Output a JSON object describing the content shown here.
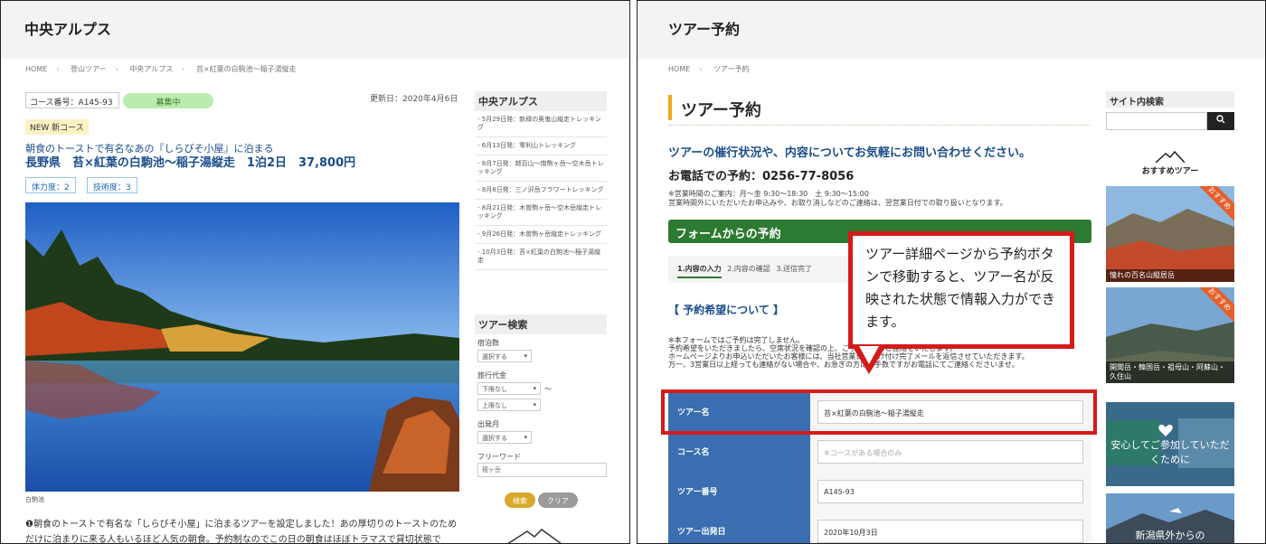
{
  "left": {
    "header_title": "中央アルプス",
    "breadcrumbs": [
      "HOME",
      "登山ツアー",
      "中央アルプス",
      "苔×紅葉の白駒池〜稲子湯縦走"
    ],
    "course_code": "コース番号：A145-93",
    "status": "募集中",
    "updated": "更新日：2020年4月6日",
    "new_tag": "NEW 新コース",
    "subtitle": "朝食のトーストで有名なあの『しらびそ小屋』に泊まる",
    "title": "長野県　苔×紅葉の白駒池〜稲子湯縦走　1泊2日　37,800円",
    "badges": [
      "体力度：2",
      "技術度：3"
    ],
    "photo_caption": "白駒池",
    "description": "❶朝食のトーストで有名な「しらびそ小屋」に泊まるツアーを設定しました！あの厚切りのトーストのためだけに泊まりに来る人もいるほど人気の朝食。予約制なのでこの日の朝食はほぼトラマスで貸切状態で",
    "sidebar": {
      "box_title": "中央アルプス",
      "items": [
        "- 5月29日発：新緑の奥鬼山縦走トレッキング",
        "- 6月13日発：零利山トレッキング",
        "- 8月7日発：越百山〜南駒ヶ岳〜空木岳トレッキング",
        "- 8月8日発：三ノ沢岳フラワートレッキング",
        "- 8月21日発：木曽駒ヶ岳〜空木岳縦走トレッキング",
        "- 9月26日発：木曽駒ヶ岳縦走トレッキング",
        "- 10月3日発：苔×紅葉の白駒池〜稲子湯縦走"
      ],
      "search_title": "ツアー検索",
      "nights_label": "宿泊数",
      "nights_value": "選択する",
      "price_label": "旅行代金",
      "price_min": "下限なし",
      "price_max": "上限なし",
      "price_sep": "〜",
      "depart_label": "出発月",
      "depart_value": "選択する",
      "keyword_label": "フリーワード",
      "keyword_placeholder": "穂ヶ岳",
      "search_button": "検索",
      "clear_button": "クリア"
    }
  },
  "right": {
    "header_title": "ツアー予約",
    "breadcrumbs": [
      "HOME",
      "ツアー予約"
    ],
    "page_title": "ツアー予約",
    "intro": "ツアーの催行状況や、内容についてお気軽にお問い合わせください。",
    "phone": "お電話での予約：0256-77-8056",
    "hours_line1": "※営業時間のご案内：月〜金 9:30〜18:30　土 9:30〜15:00",
    "hours_line2": "営業時間外にいただいたお申込みや、お取り消しなどのご連絡は、翌営業日付での取り扱いとなります。",
    "form_bar": "フォームからの予約",
    "steps": [
      "1.内容の入力",
      "2.内容の確認",
      "3.送信完了"
    ],
    "section_title": "【 予約希望について 】",
    "notes": [
      "※本フォームではご予約は完了しません。",
      "予約希望をいただきましたら、空席状況を確認の上、ご予約確定のご連絡をいたします。",
      "ホームページよりお申込いただいたお客様には、当社営業日に受け付け完了メールを返信させていただきます。",
      "万一、3営業日以上経っても連絡がない場合や、お急ぎの方はお手数ですがお電話にてご連絡くださいませ。"
    ],
    "form": [
      {
        "label": "ツアー名",
        "value": "苔×紅葉の白駒池〜稲子湯縦走",
        "placeholder": ""
      },
      {
        "label": "コース名",
        "value": "",
        "placeholder": "※コースがある場合のみ"
      },
      {
        "label": "ツアー番号",
        "value": "A145-93",
        "placeholder": ""
      },
      {
        "label": "ツアー出発日",
        "value": "2020年10月3日",
        "placeholder": ""
      }
    ],
    "callout": "ツアー詳細ページから予約ボタンで移動すると、ツアー名が反映された状態で情報入力ができます。",
    "sidebar": {
      "search_title": "サイト内検索",
      "search_icon": "magnifier-icon",
      "recommend_title": "おすすめツアー",
      "cards": [
        {
          "caption": "憧れの百名山縦居岳",
          "ribbon": "おすすめ"
        },
        {
          "caption": "開聞岳・韓国岳・祖母山・阿蘇山・久住山",
          "ribbon": "おすすめ"
        },
        {
          "caption": "安心してご参加していただくために",
          "ribbon": ""
        },
        {
          "caption": "新潟県外からの",
          "ribbon": ""
        }
      ]
    }
  },
  "colors": {
    "blue_title": "#1a4d8a",
    "form_label_bg": "#3a6eb0",
    "green_bar": "#2d7a32",
    "highlight_red": "#d61a1a",
    "status_green": "#b9ecae",
    "accent_orange": "#f0a81a"
  }
}
